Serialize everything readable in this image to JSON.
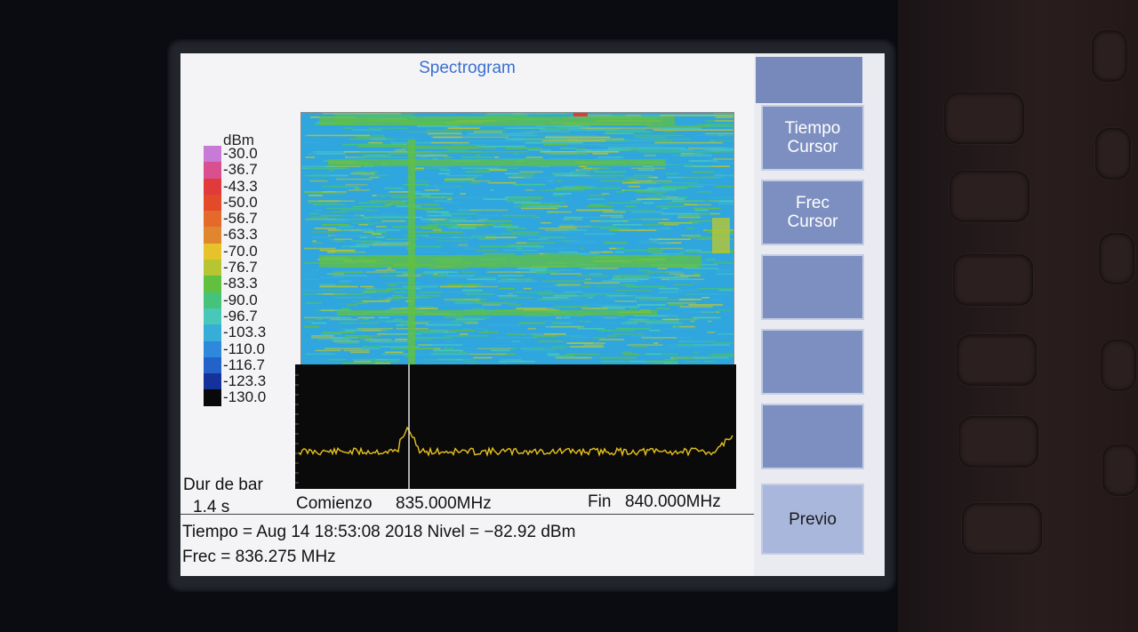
{
  "screen": {
    "title": "Spectrogram"
  },
  "colorscale": {
    "unit": "dBm",
    "levels": [
      {
        "label": "-30.0",
        "color": "#c77ad6"
      },
      {
        "label": "-36.7",
        "color": "#d8508f"
      },
      {
        "label": "-43.3",
        "color": "#e03a3a"
      },
      {
        "label": "-50.0",
        "color": "#e34a2a"
      },
      {
        "label": "-56.7",
        "color": "#e36a2a"
      },
      {
        "label": "-63.3",
        "color": "#e0862f"
      },
      {
        "label": "-70.0",
        "color": "#e6c32a"
      },
      {
        "label": "-76.7",
        "color": "#b8c533"
      },
      {
        "label": "-83.3",
        "color": "#62c040"
      },
      {
        "label": "-90.0",
        "color": "#45c37a"
      },
      {
        "label": "-96.7",
        "color": "#49c8ba"
      },
      {
        "label": "-103.3",
        "color": "#36aed8"
      },
      {
        "label": "-110.0",
        "color": "#2e88dc"
      },
      {
        "label": "-116.7",
        "color": "#2362c8"
      },
      {
        "label": "-123.3",
        "color": "#15319a"
      },
      {
        "label": "-130.0",
        "color": "#090909"
      }
    ]
  },
  "footer": {
    "dur_label": "Dur de bar",
    "dur_value": "1.4 s",
    "start_label": "Comienzo",
    "start_value": "835.000MHz",
    "end_label": "Fin",
    "end_value": "840.000MHz",
    "info_time": "Tiempo = Aug 14 18:53:08 2018 Nivel = −82.92 dBm",
    "info_freq": "Frec = 836.275 MHz"
  },
  "softkeys": [
    {
      "label_1": "Tiempo",
      "label_2": "Cursor"
    },
    {
      "label_1": "Frec",
      "label_2": "Cursor"
    },
    {
      "label_1": "",
      "label_2": ""
    },
    {
      "label_1": "",
      "label_2": ""
    },
    {
      "label_1": "",
      "label_2": ""
    },
    {
      "label_1": "Previo",
      "label_2": ""
    }
  ]
}
